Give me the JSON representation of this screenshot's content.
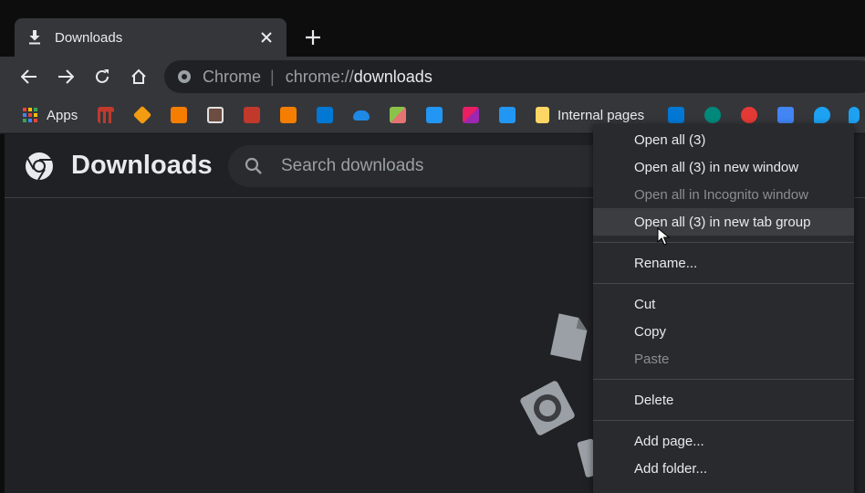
{
  "tab": {
    "title": "Downloads",
    "close_symbol": "✕"
  },
  "newtab_symbol": "+",
  "omnibox": {
    "chip": "Chrome",
    "separator": "|",
    "scheme": "chrome://",
    "host": "downloads"
  },
  "bookmarks": {
    "apps_label": "Apps",
    "folder_label": "Internal pages"
  },
  "page": {
    "title": "Downloads",
    "search_placeholder": "Search downloads"
  },
  "menu": {
    "open_all": "Open all (3)",
    "open_all_new_window": "Open all (3) in new window",
    "open_all_incognito": "Open all in Incognito window",
    "open_all_tab_group": "Open all (3) in new tab group",
    "rename": "Rename...",
    "cut": "Cut",
    "copy": "Copy",
    "paste": "Paste",
    "delete": "Delete",
    "add_page": "Add page...",
    "add_folder": "Add folder..."
  },
  "colors": {
    "frame": "#0d0d0d",
    "toolbar": "#35363a",
    "page_bg": "#202124",
    "menu_bg": "#292a2d",
    "text": "#e8eaed",
    "muted": "#9aa0a6"
  }
}
